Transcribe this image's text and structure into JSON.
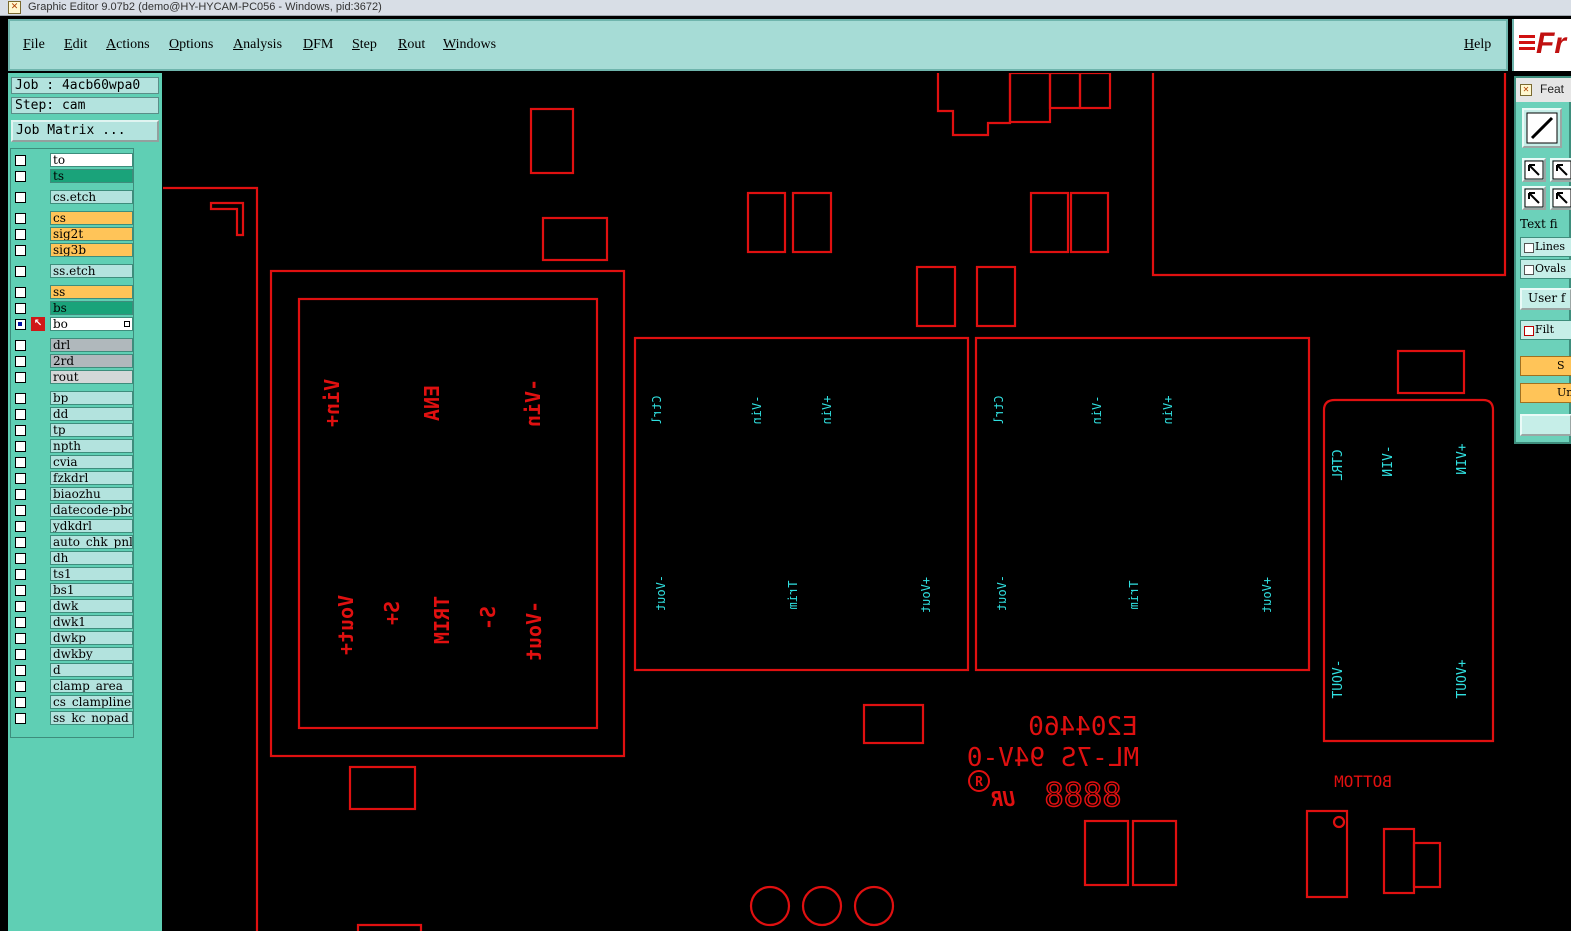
{
  "window": {
    "title": "Graphic Editor 9.07b2 (demo@HY-HYCAM-PC056 - Windows, pid:3672)"
  },
  "menu": [
    "File",
    "Edit",
    "Actions",
    "Options",
    "Analysis",
    "DFM",
    "Step",
    "Rout",
    "Windows"
  ],
  "help_label": "Help",
  "logo_text": "Fr",
  "job": {
    "job_line": "Job : 4acb60wpa0",
    "step_line": "Step: cam",
    "matrix_button": "Job Matrix ..."
  },
  "layers": [
    {
      "name": "to",
      "color": "#ffffff"
    },
    {
      "name": "ts",
      "color": "#1aa37a"
    },
    {
      "name": "cs.etch",
      "color": "#b3e3de"
    },
    {
      "name": "cs",
      "color": "#ffc458"
    },
    {
      "name": "sig2t",
      "color": "#ffc458"
    },
    {
      "name": "sig3b",
      "color": "#ffc458"
    },
    {
      "name": "ss.etch",
      "color": "#b3e3de"
    },
    {
      "name": "ss",
      "color": "#ffc458"
    },
    {
      "name": "bs",
      "color": "#1aa37a"
    },
    {
      "name": "bo",
      "color": "#ffffff",
      "active": true
    },
    {
      "name": "drl",
      "color": "#b0b8bc"
    },
    {
      "name": "2rd",
      "color": "#b0b8bc"
    },
    {
      "name": "rout",
      "color": "#d4d8d8"
    },
    {
      "name": "bp",
      "color": "#b3e3de"
    },
    {
      "name": "dd",
      "color": "#b3e3de"
    },
    {
      "name": "tp",
      "color": "#b3e3de"
    },
    {
      "name": "npth",
      "color": "#b3e3de"
    },
    {
      "name": "cvia",
      "color": "#b3e3de"
    },
    {
      "name": "fzkdrl",
      "color": "#b3e3de"
    },
    {
      "name": "biaozhu",
      "color": "#b3e3de"
    },
    {
      "name": "datecode-pbc",
      "color": "#b3e3de"
    },
    {
      "name": "ydkdrl",
      "color": "#b3e3de"
    },
    {
      "name": "auto_chk_pnl",
      "color": "#b3e3de"
    },
    {
      "name": "dh",
      "color": "#b3e3de"
    },
    {
      "name": "ts1",
      "color": "#b3e3de"
    },
    {
      "name": "bs1",
      "color": "#b3e3de"
    },
    {
      "name": "dwk",
      "color": "#b3e3de"
    },
    {
      "name": "dwk1",
      "color": "#b3e3de"
    },
    {
      "name": "dwkp",
      "color": "#b3e3de"
    },
    {
      "name": "dwkby",
      "color": "#b3e3de"
    },
    {
      "name": "d",
      "color": "#b3e3de"
    },
    {
      "name": "clamp_area",
      "color": "#b3e3de"
    },
    {
      "name": "cs_clampline",
      "color": "#b3e3de"
    },
    {
      "name": "ss_kc_nopad",
      "color": "#b3e3de"
    }
  ],
  "feature_panel": {
    "title": "Feat",
    "text_label": "Text fi",
    "lines_label": "Lines",
    "ovals_label": "Ovals",
    "user_label": "User f",
    "filter_label": "Filt",
    "btn1": "S",
    "btn2": "Un"
  },
  "canvas": {
    "red_texts": [
      "Vin+",
      "ENA",
      "-Vin",
      "Vout+",
      "S+",
      "TRIM",
      "S-",
      "-Vout"
    ],
    "module1_texts": [
      "Ctrl",
      "-Vin",
      "+Vin",
      "-Vout",
      "Trim",
      "+Vout"
    ],
    "module2_texts": [
      "Ctrl",
      "-Vin",
      "+Vin",
      "-Vout",
      "Trim",
      "+Vout"
    ],
    "module3_texts": [
      "CTRL",
      "-VIN",
      "+VIN",
      "-VOUT",
      "+VOUT"
    ],
    "marking_lines": [
      "E204460",
      "ML-7S 94V-0",
      "8888"
    ],
    "bottom_label": "BOTTOM",
    "colors": {
      "silk_red": "#e01010",
      "text_cyan": "#30e0e0"
    }
  }
}
